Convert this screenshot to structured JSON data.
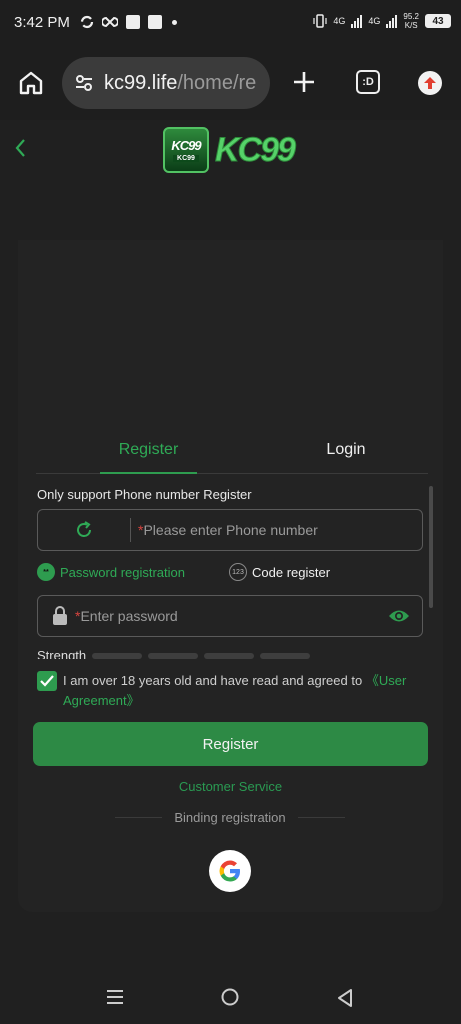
{
  "status_bar": {
    "time": "3:42 PM",
    "net1": "4G",
    "net2": "4G",
    "speed_value": "95.2",
    "speed_unit": "K/S",
    "battery": "43"
  },
  "browser": {
    "url_host": "kc99.life",
    "url_path": "/home/re"
  },
  "brand": {
    "badge_big": "KC99",
    "badge_small": "KC99",
    "logo_text": "KC99"
  },
  "tabs": {
    "register": "Register",
    "login": "Login"
  },
  "form": {
    "hint": "Only support Phone number Register",
    "phone_placeholder": "Please enter Phone number",
    "mode_password": "Password registration",
    "mode_password_icon": "**",
    "mode_code": "Code register",
    "mode_code_icon": "123",
    "password_placeholder": "Enter password",
    "strength_label": "Strength",
    "agreement_text": "I am over 18 years old and have read and agreed to",
    "agreement_link": "《User Agreement》",
    "agreement_checked": true,
    "submit": "Register",
    "customer_service": "Customer Service",
    "binding": "Binding registration",
    "required_mark": "*"
  },
  "colors": {
    "accent": "#2e9c4f",
    "background": "#202020",
    "card": "#232323"
  }
}
